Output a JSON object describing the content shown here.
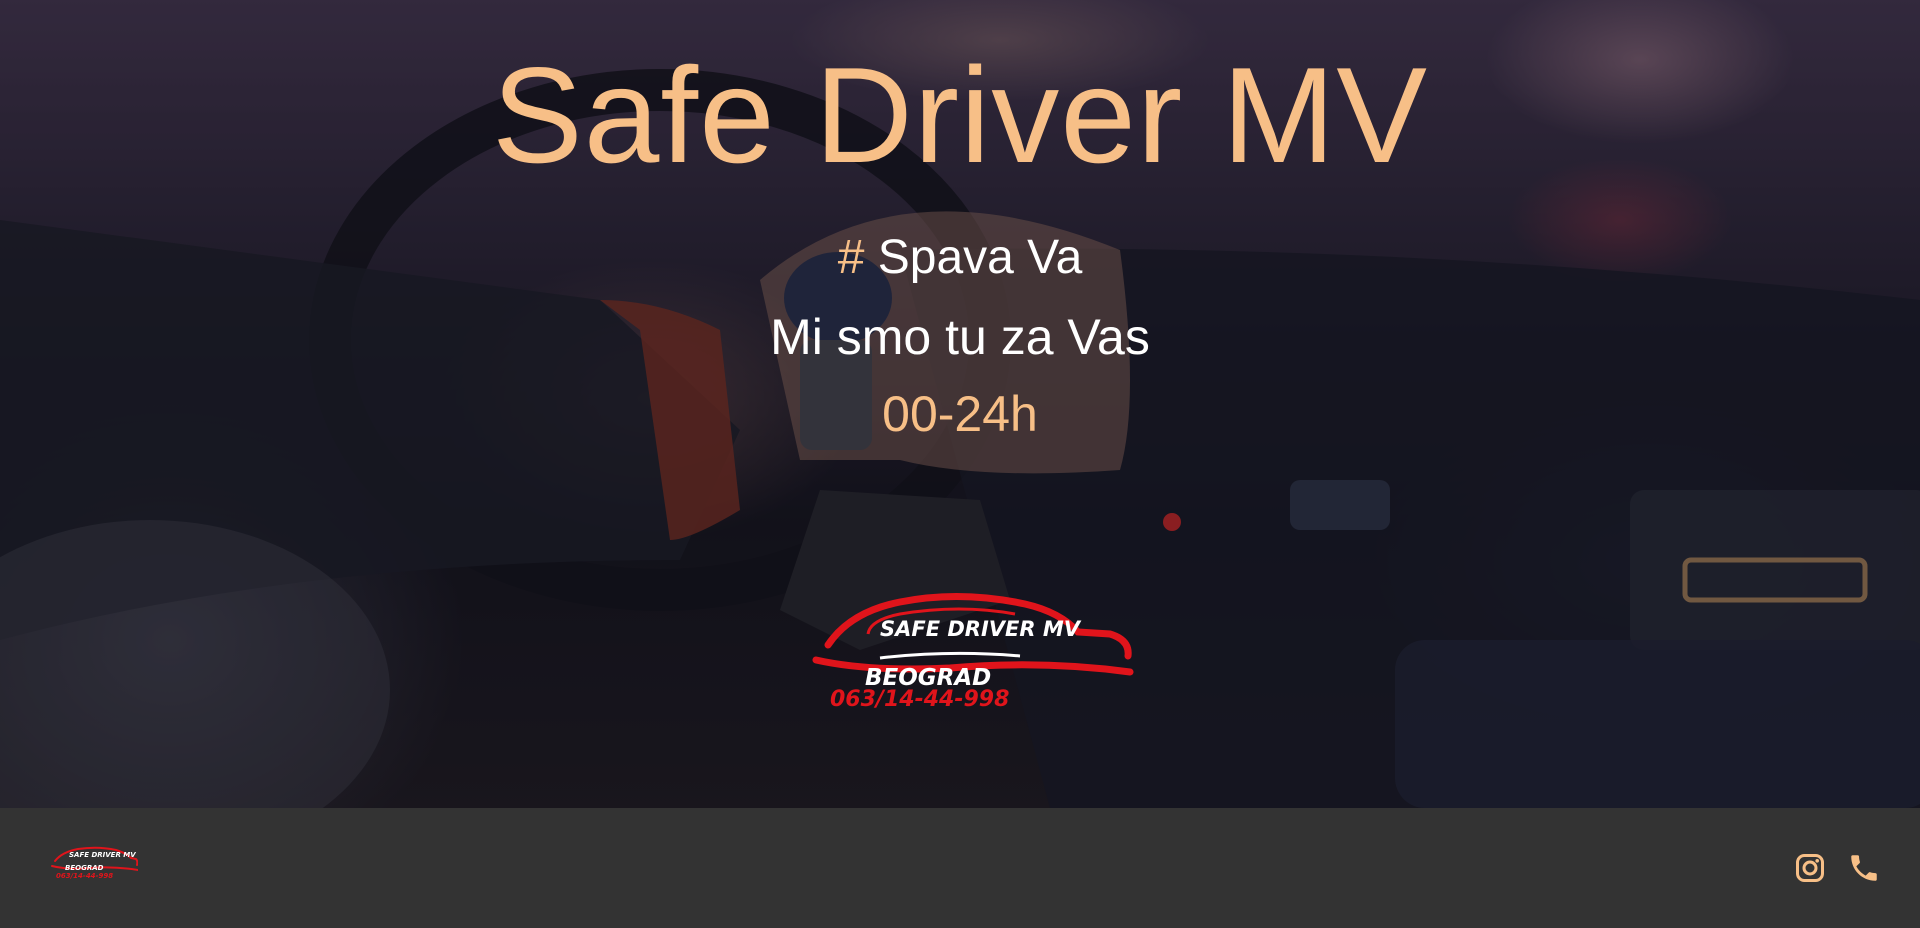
{
  "hero": {
    "title": "Safe Driver MV",
    "tag_hash": "#",
    "tag_text": " Spava Va",
    "motto": "Mi smo tu za Vas",
    "hours": "00-24h"
  },
  "logo": {
    "brand": "SAFE DRIVER MV",
    "city": "BEOGRAD",
    "phone": "063/14-44-998"
  },
  "footer": {
    "icons": [
      "instagram-icon",
      "phone-icon"
    ]
  },
  "colors": {
    "accent": "#f7bf87",
    "logo_red": "#e0141b",
    "footer_bg": "#333333"
  }
}
